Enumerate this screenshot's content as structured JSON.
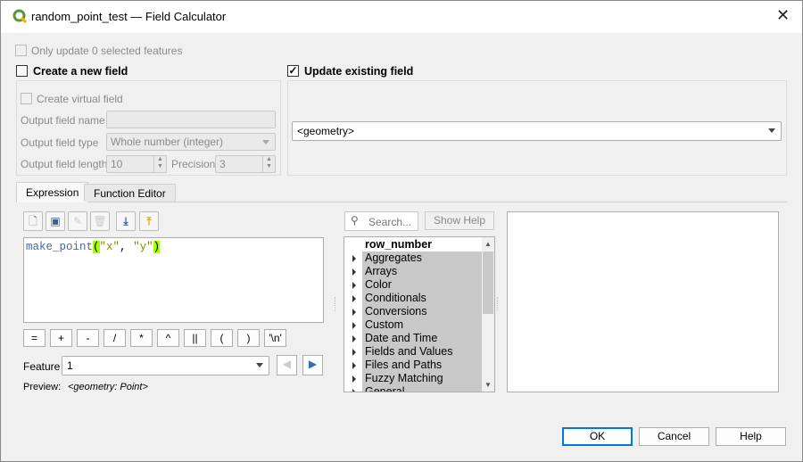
{
  "window": {
    "title": "random_point_test — Field Calculator",
    "close": "✕"
  },
  "only_update": {
    "label": "Only update 0 selected features",
    "checked": false,
    "enabled": false
  },
  "create_new": {
    "label": "Create a new field",
    "checked": false,
    "virtual_label": "Create virtual field",
    "name_label": "Output field name",
    "name_value": "",
    "type_label": "Output field type",
    "type_value": "Whole number (integer)",
    "length_label": "Output field length",
    "length_value": "10",
    "precision_label": "Precision",
    "precision_value": "3"
  },
  "update_existing": {
    "label": "Update existing field",
    "checked": true,
    "field": "<geometry>"
  },
  "tabs": [
    {
      "label": "Expression",
      "active": true
    },
    {
      "label": "Function Editor",
      "active": false
    }
  ],
  "toolbar": [
    "new-file-icon",
    "save-icon",
    "edit-icon",
    "delete-icon",
    "import-icon",
    "export-icon"
  ],
  "expression": {
    "fn": "make_point",
    "open": "(",
    "a1": "\"x\"",
    "sep": ", ",
    "a2": "\"y\"",
    "close": ")"
  },
  "operators": [
    "=",
    "+",
    "-",
    "/",
    "*",
    "^",
    "||",
    "(",
    ")",
    "'\\n'"
  ],
  "feature": {
    "label": "Feature",
    "value": "1"
  },
  "preview": {
    "label": "Preview:",
    "value": "<geometry: Point>"
  },
  "search": {
    "placeholder": "Search..."
  },
  "show_help": "Show Help",
  "tree": {
    "header": "row_number",
    "items": [
      "Aggregates",
      "Arrays",
      "Color",
      "Conditionals",
      "Conversions",
      "Custom",
      "Date and Time",
      "Fields and Values",
      "Files and Paths",
      "Fuzzy Matching",
      "General"
    ]
  },
  "buttons": {
    "ok": "OK",
    "cancel": "Cancel",
    "help": "Help"
  }
}
